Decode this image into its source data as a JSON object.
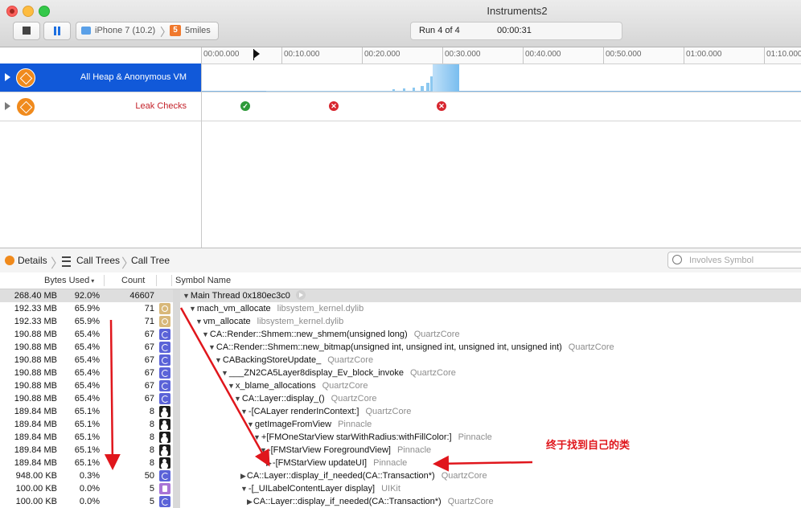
{
  "window": {
    "title": "Instruments2"
  },
  "toolbar": {
    "target_device": "iPhone 7 (10.2)",
    "target_app": "5miles",
    "app_badge": "5",
    "run_label": "Run 4 of 4",
    "run_time": "00:00:31"
  },
  "timeline": {
    "ticks": [
      "00:00.000",
      "00:10.000",
      "00:20.000",
      "00:30.000",
      "00:40.000",
      "00:50.000",
      "01:00.000",
      "01:10.000"
    ],
    "tracks": [
      {
        "label": "All Heap & Anonymous VM",
        "selected": true,
        "icon": "allocations-icon"
      },
      {
        "label": "Leak Checks",
        "selected": false,
        "icon": "leaks-icon"
      }
    ],
    "leak_marks": [
      "ok",
      "leak",
      "leak"
    ],
    "colors": {
      "selection": "#1159d9",
      "heap_bar": "#8cc8f0",
      "leak_ok": "#2e9a3a",
      "leak_bad": "#d7262f"
    }
  },
  "details": {
    "crumbs": [
      "Details",
      "Call Trees",
      "Call Tree"
    ],
    "search_placeholder": "Involves Symbol"
  },
  "table": {
    "headers": {
      "bytes": "Bytes Used",
      "count": "Count",
      "symbol": "Symbol Name"
    },
    "rows": [
      {
        "bytes": "268.40 MB",
        "pct": "92.0%",
        "count": "46607",
        "icon": "",
        "indent": 0,
        "disc": "open",
        "symbol": "Main Thread  0x180ec3c0",
        "lib": ""
      },
      {
        "bytes": "192.33 MB",
        "pct": "65.9%",
        "count": "71",
        "icon": "gear",
        "indent": 1,
        "disc": "open",
        "symbol": "mach_vm_allocate",
        "lib": "libsystem_kernel.dylib"
      },
      {
        "bytes": "192.33 MB",
        "pct": "65.9%",
        "count": "71",
        "icon": "gear",
        "indent": 2,
        "disc": "open",
        "symbol": "vm_allocate",
        "lib": "libsystem_kernel.dylib"
      },
      {
        "bytes": "190.88 MB",
        "pct": "65.4%",
        "count": "67",
        "icon": "pie",
        "indent": 3,
        "disc": "open",
        "symbol": "CA::Render::Shmem::new_shmem(unsigned long)",
        "lib": "QuartzCore"
      },
      {
        "bytes": "190.88 MB",
        "pct": "65.4%",
        "count": "67",
        "icon": "pie",
        "indent": 4,
        "disc": "open",
        "symbol": "CA::Render::Shmem::new_bitmap(unsigned int, unsigned int, unsigned int, unsigned int)",
        "lib": "QuartzCore"
      },
      {
        "bytes": "190.88 MB",
        "pct": "65.4%",
        "count": "67",
        "icon": "pie",
        "indent": 5,
        "disc": "open",
        "symbol": "CABackingStoreUpdate_",
        "lib": "QuartzCore"
      },
      {
        "bytes": "190.88 MB",
        "pct": "65.4%",
        "count": "67",
        "icon": "pie",
        "indent": 6,
        "disc": "open",
        "symbol": "___ZN2CA5Layer8display_Ev_block_invoke",
        "lib": "QuartzCore"
      },
      {
        "bytes": "190.88 MB",
        "pct": "65.4%",
        "count": "67",
        "icon": "pie",
        "indent": 7,
        "disc": "open",
        "symbol": "x_blame_allocations",
        "lib": "QuartzCore"
      },
      {
        "bytes": "190.88 MB",
        "pct": "65.4%",
        "count": "67",
        "icon": "pie",
        "indent": 8,
        "disc": "open",
        "symbol": "CA::Layer::display_()",
        "lib": "QuartzCore"
      },
      {
        "bytes": "189.84 MB",
        "pct": "65.1%",
        "count": "8",
        "icon": "user",
        "indent": 9,
        "disc": "open",
        "symbol": "-[CALayer renderInContext:]",
        "lib": "QuartzCore"
      },
      {
        "bytes": "189.84 MB",
        "pct": "65.1%",
        "count": "8",
        "icon": "user",
        "indent": 10,
        "disc": "open",
        "symbol": "getImageFromView",
        "lib": "Pinnacle"
      },
      {
        "bytes": "189.84 MB",
        "pct": "65.1%",
        "count": "8",
        "icon": "user",
        "indent": 11,
        "disc": "open",
        "symbol": "+[FMOneStarView starWithRadius:withFillColor:]",
        "lib": "Pinnacle"
      },
      {
        "bytes": "189.84 MB",
        "pct": "65.1%",
        "count": "8",
        "icon": "user",
        "indent": 12,
        "disc": "open",
        "symbol": "-[FMStarView ForegroundView]",
        "lib": "Pinnacle"
      },
      {
        "bytes": "189.84 MB",
        "pct": "65.1%",
        "count": "8",
        "icon": "user",
        "indent": 13,
        "disc": "closed",
        "symbol": "-[FMStarView updateUI]",
        "lib": "Pinnacle"
      },
      {
        "bytes": "948.00 KB",
        "pct": "0.3%",
        "count": "50",
        "icon": "pie",
        "indent": 9,
        "disc": "closed",
        "symbol": "CA::Layer::display_if_needed(CA::Transaction*)",
        "lib": "QuartzCore"
      },
      {
        "bytes": "100.00 KB",
        "pct": "0.0%",
        "count": "5",
        "icon": "doc",
        "indent": 9,
        "disc": "open",
        "symbol": "-[_UILabelContentLayer display]",
        "lib": "UIKit"
      },
      {
        "bytes": "100.00 KB",
        "pct": "0.0%",
        "count": "5",
        "icon": "pie",
        "indent": 10,
        "disc": "closed",
        "symbol": "CA::Layer::display_if_needed(CA::Transaction*)",
        "lib": "QuartzCore"
      }
    ]
  },
  "annotation": {
    "text": "终于找到自己的类",
    "color": "#e0161c"
  }
}
